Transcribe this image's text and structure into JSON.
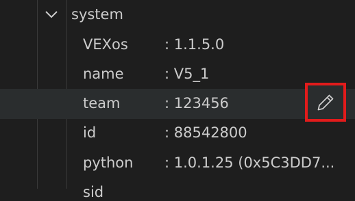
{
  "tree": {
    "group_label": "system",
    "items": [
      {
        "key": "VEXos",
        "value": ": 1.1.5.0"
      },
      {
        "key": "name",
        "value": ": V5_1"
      },
      {
        "key": "team",
        "value": ": 123456"
      },
      {
        "key": "id",
        "value": ": 88542800"
      },
      {
        "key": "python",
        "value": ": 1.0.1.25 (0x5C3DD7..."
      }
    ],
    "partial_item_key": "sid"
  },
  "icons": {
    "chevron": "chevron-down-icon",
    "edit": "pencil-icon"
  },
  "colors": {
    "background": "#1e1e1e",
    "selected_row": "#2a2d2e",
    "text": "#cccccc",
    "highlight_border": "#e21b1b"
  }
}
